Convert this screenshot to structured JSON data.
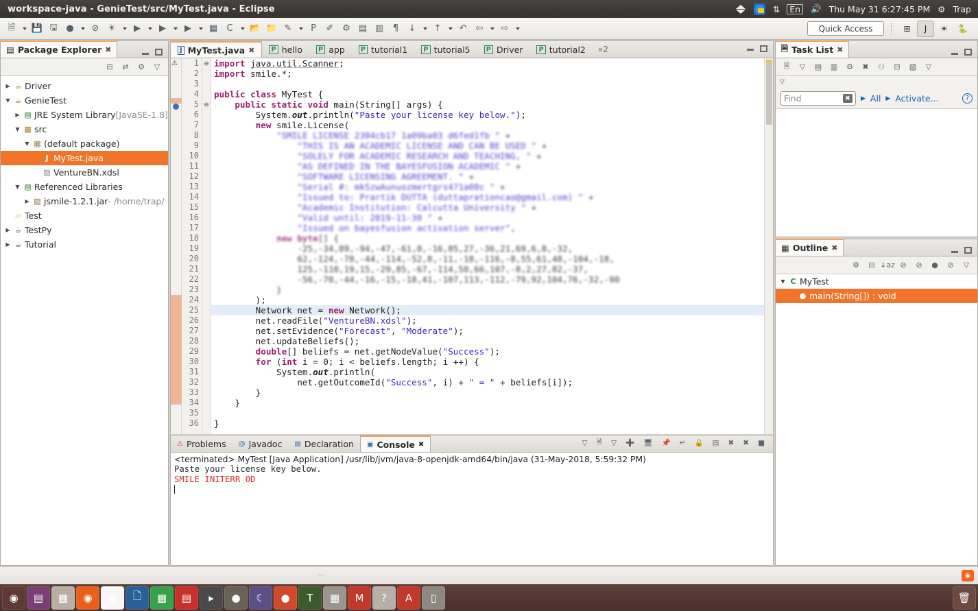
{
  "window": {
    "title": "workspace-java - GenieTest/src/MyTest.java - Eclipse"
  },
  "tray": {
    "dropbox": "dropbox-icon",
    "teamviewer": "teamviewer-icon",
    "network": "network-updown-icon",
    "keyboard_layout": "En",
    "volume": "volume-icon",
    "datetime": "Thu May 31  6:27:45 PM",
    "session_gear": "session-gear-icon",
    "user": "Trap"
  },
  "toolbar": {
    "quick_access": "Quick Access",
    "buttons": [
      {
        "name": "new-wizard",
        "glyph": "🗎"
      },
      {
        "name": "new-wizard-dropdown",
        "glyph": "caret"
      },
      {
        "name": "save",
        "glyph": "💾"
      },
      {
        "name": "save-all",
        "glyph": "🖫"
      },
      {
        "name": "toggle-breadcrumb",
        "glyph": "●"
      },
      {
        "name": "breadcrumb-dropdown",
        "glyph": "caret"
      },
      {
        "name": "skip-breakpoints",
        "glyph": "⊘"
      },
      {
        "name": "debug",
        "glyph": "☀"
      },
      {
        "name": "debug-dropdown",
        "glyph": "caret"
      },
      {
        "name": "run",
        "glyph": "▶"
      },
      {
        "name": "run-dropdown",
        "glyph": "caret"
      },
      {
        "name": "run-external-tools",
        "glyph": "▶"
      },
      {
        "name": "external-tools-dropdown",
        "glyph": "caret"
      },
      {
        "name": "coverage",
        "glyph": "▶"
      },
      {
        "name": "coverage-dropdown",
        "glyph": "caret"
      },
      {
        "name": "new-java-package",
        "glyph": "▦"
      },
      {
        "name": "new-java-class",
        "glyph": "C"
      },
      {
        "name": "new-class-dropdown",
        "glyph": "caret"
      },
      {
        "name": "open-type",
        "glyph": "📂"
      },
      {
        "name": "open-task",
        "glyph": "📁"
      },
      {
        "name": "new-pydev-project",
        "glyph": "✎"
      },
      {
        "name": "pydev-dropdown",
        "glyph": "caret"
      },
      {
        "name": "pydev-package",
        "glyph": "P"
      },
      {
        "name": "pydev-module",
        "glyph": "✐"
      },
      {
        "name": "globals-browser",
        "glyph": "⚙"
      },
      {
        "name": "open-declaration",
        "glyph": "▤"
      },
      {
        "name": "comment-block",
        "glyph": "▥"
      },
      {
        "name": "show-whitespace",
        "glyph": "¶"
      },
      {
        "name": "next-annotation",
        "glyph": "↓"
      },
      {
        "name": "next-annotation-dropdown",
        "glyph": "caret"
      },
      {
        "name": "previous-annotation",
        "glyph": "↑"
      },
      {
        "name": "previous-annotation-dropdown",
        "glyph": "caret"
      },
      {
        "name": "last-edit-location",
        "glyph": "↶"
      },
      {
        "name": "back",
        "glyph": "⇦"
      },
      {
        "name": "back-dropdown",
        "glyph": "caret"
      },
      {
        "name": "forward",
        "glyph": "⇨"
      },
      {
        "name": "forward-dropdown",
        "glyph": "caret"
      }
    ],
    "perspectives": [
      {
        "name": "open-perspective",
        "glyph": "⊞",
        "active": false
      },
      {
        "name": "perspective-java",
        "glyph": "J",
        "active": true
      },
      {
        "name": "perspective-debug",
        "glyph": "☀",
        "active": false
      },
      {
        "name": "perspective-pydev",
        "glyph": "🐍",
        "active": false
      }
    ]
  },
  "package_explorer": {
    "title": "Package Explorer",
    "toolbar": [
      {
        "name": "collapse-all",
        "glyph": "⊟"
      },
      {
        "name": "link-with-editor",
        "glyph": "⇄"
      },
      {
        "name": "view-menu-filters",
        "glyph": "⚙"
      },
      {
        "name": "view-menu",
        "glyph": "▽"
      }
    ],
    "tree": [
      {
        "label": "Driver",
        "icon": "java-project-icon",
        "indent": 0,
        "twisty": "collapsed",
        "selected": false
      },
      {
        "label": "GenieTest",
        "icon": "java-project-icon",
        "indent": 0,
        "twisty": "expanded",
        "selected": false
      },
      {
        "label": "JRE System Library",
        "suffix": "[JavaSE-1.8]",
        "icon": "library-icon",
        "indent": 1,
        "twisty": "collapsed",
        "selected": false
      },
      {
        "label": "src",
        "icon": "source-folder-icon",
        "indent": 1,
        "twisty": "expanded",
        "selected": false
      },
      {
        "label": "(default package)",
        "icon": "package-icon",
        "indent": 2,
        "twisty": "expanded",
        "selected": false
      },
      {
        "label": "MyTest.java",
        "icon": "java-file-icon",
        "indent": 3,
        "twisty": "none",
        "selected": true
      },
      {
        "label": "VentureBN.xdsl",
        "icon": "xml-file-icon",
        "indent": 3,
        "twisty": "none",
        "selected": false
      },
      {
        "label": "Referenced Libraries",
        "icon": "library-icon",
        "indent": 1,
        "twisty": "expanded",
        "selected": false
      },
      {
        "label": "jsmile-1.2.1.jar",
        "suffix": "- /home/trap/",
        "icon": "jar-icon",
        "indent": 2,
        "twisty": "collapsed",
        "selected": false
      },
      {
        "label": "Test",
        "icon": "folder-icon",
        "indent": 0,
        "twisty": "none",
        "selected": false
      },
      {
        "label": "TestPy",
        "icon": "python-project-icon",
        "indent": 0,
        "twisty": "collapsed",
        "selected": false
      },
      {
        "label": "Tutorial",
        "icon": "python-project-icon",
        "indent": 0,
        "twisty": "collapsed",
        "selected": false
      }
    ]
  },
  "editor": {
    "tabs": [
      {
        "label": "MyTest.java",
        "icon": "java-file-icon",
        "active": true,
        "closable": true
      },
      {
        "label": "hello",
        "icon": "python-file-icon",
        "active": false,
        "closable": false
      },
      {
        "label": "app",
        "icon": "python-file-icon",
        "active": false,
        "closable": false
      },
      {
        "label": "tutorial1",
        "icon": "python-file-icon",
        "active": false,
        "closable": false
      },
      {
        "label": "tutorial5",
        "icon": "python-file-icon",
        "active": false,
        "closable": false
      },
      {
        "label": "Driver",
        "icon": "python-file-icon",
        "active": false,
        "closable": false
      },
      {
        "label": "tutorial2",
        "icon": "python-file-icon",
        "active": false,
        "closable": false
      }
    ],
    "overflow_label": "»2",
    "lines": [
      {
        "n": 1,
        "fold": "⊖",
        "blurred": false,
        "html": "<span class=\"kw\">import</span> <span class=\"plain imp\">java.util.Scanner</span><span class=\"plain\">;</span>"
      },
      {
        "n": 2,
        "fold": "",
        "blurred": false,
        "html": "<span class=\"kw\">import</span> <span class=\"plain\">smile.*;</span>"
      },
      {
        "n": 3,
        "fold": "",
        "blurred": false,
        "html": ""
      },
      {
        "n": 4,
        "fold": "",
        "blurred": false,
        "html": "<span class=\"kw\">public class</span> <span class=\"plain\">MyTest {</span>"
      },
      {
        "n": 5,
        "fold": "⊖",
        "blurred": false,
        "html": "    <span class=\"kw\">public static void</span> <span class=\"plain\">main(String[] args) {</span>"
      },
      {
        "n": 6,
        "fold": "",
        "blurred": false,
        "html": "        <span class=\"plain\">System.</span><span class=\"fld\">out</span><span class=\"plain\">.println(</span><span class=\"str\">\"Paste your license key below.\"</span><span class=\"plain\">);</span>"
      },
      {
        "n": 7,
        "fold": "",
        "blurred": false,
        "html": "        <span class=\"kw\">new</span> <span class=\"plain\">smile.License(</span>"
      },
      {
        "n": 8,
        "fold": "",
        "blurred": true,
        "html": "            <span class=\"str\">\"SMILE LICENSE 2304cb17 1a09ba03 d6fed1fb \"</span> <span class=\"plain\">+</span>"
      },
      {
        "n": 9,
        "fold": "",
        "blurred": true,
        "html": "                <span class=\"str\">\"THIS IS AN ACADEMIC LICENSE AND CAN BE USED \"</span> <span class=\"plain\">+</span>"
      },
      {
        "n": 10,
        "fold": "",
        "blurred": true,
        "html": "                <span class=\"str\">\"SOLELY FOR ACADEMIC RESEARCH AND TEACHING, \"</span> <span class=\"plain\">+</span>"
      },
      {
        "n": 11,
        "fold": "",
        "blurred": true,
        "html": "                <span class=\"str\">\"AS DEFINED IN THE BAYESFUSION ACADEMIC \"</span> <span class=\"plain\">+</span>"
      },
      {
        "n": 12,
        "fold": "",
        "blurred": true,
        "html": "                <span class=\"str\">\"SOFTWARE LICENSING AGREEMENT. \"</span> <span class=\"plain\">+</span>"
      },
      {
        "n": 13,
        "fold": "",
        "blurred": true,
        "html": "                <span class=\"str\">\"Serial #: mk5zwAunuozmertgrs471a00c \"</span> <span class=\"plain\">+</span>"
      },
      {
        "n": 14,
        "fold": "",
        "blurred": true,
        "html": "                <span class=\"str\">\"Issued to: Prartik DUTTA (duttaprationcao@gmail.com) \"</span> <span class=\"plain\">+</span>"
      },
      {
        "n": 15,
        "fold": "",
        "blurred": true,
        "html": "                <span class=\"str\">\"Academic Institution: Calcutta University \"</span> <span class=\"plain\">+</span>"
      },
      {
        "n": 16,
        "fold": "",
        "blurred": true,
        "html": "                <span class=\"str\">\"Valid until: 2019-11-30 \"</span> <span class=\"plain\">+</span>"
      },
      {
        "n": 17,
        "fold": "",
        "blurred": true,
        "html": "                <span class=\"str\">\"Issued on bayesfusion activation server\"</span><span class=\"plain\">,</span>"
      },
      {
        "n": 18,
        "fold": "",
        "blurred": true,
        "html": "            <span class=\"kw\">new</span> <span class=\"kw\">byte</span><span class=\"plain\">[] {</span>"
      },
      {
        "n": 19,
        "fold": "",
        "blurred": true,
        "html": "                <span class=\"plain\">-25,-34,89,-94,-47,-61,0,-16,85,27,-36,21,69,6,8,-32,</span>"
      },
      {
        "n": 20,
        "fold": "",
        "blurred": true,
        "html": "                <span class=\"plain\">62,-124,-78,-44,-114,-52,8,-11,-18,-116,-8,55,61,48,-104,-18,</span>"
      },
      {
        "n": 21,
        "fold": "",
        "blurred": true,
        "html": "                <span class=\"plain\">125,-110,19,15,-29,85,-67,-114,50,66,107,-8,2,27,82,-37,</span>"
      },
      {
        "n": 22,
        "fold": "",
        "blurred": true,
        "html": "                <span class=\"plain\">-56,-70,-44,-16,-15,-18,41,-107,113,-112,-79,92,104,76,-32,-90</span>"
      },
      {
        "n": 23,
        "fold": "",
        "blurred": true,
        "html": "            <span class=\"plain\">}</span>"
      },
      {
        "n": 24,
        "fold": "",
        "blurred": false,
        "html": "        <span class=\"plain\">);</span>"
      },
      {
        "n": 25,
        "fold": "",
        "blurred": false,
        "html": "        <span class=\"plain\">Network net = </span><span class=\"kw\">new</span><span class=\"plain\"> Network();</span>"
      },
      {
        "n": 26,
        "fold": "",
        "blurred": false,
        "html": "        <span class=\"plain\">net.readFile(</span><span class=\"str\">\"VentureBN.xdsl\"</span><span class=\"plain\">);</span>"
      },
      {
        "n": 27,
        "fold": "",
        "blurred": false,
        "html": "        <span class=\"plain\">net.setEvidence(</span><span class=\"str\">\"Forecast\"</span><span class=\"plain\">, </span><span class=\"str\">\"Moderate\"</span><span class=\"plain\">);</span>"
      },
      {
        "n": 28,
        "fold": "",
        "blurred": false,
        "html": "        <span class=\"plain\">net.updateBeliefs();</span>"
      },
      {
        "n": 29,
        "fold": "",
        "blurred": false,
        "html": "        <span class=\"kw\">double</span><span class=\"plain\">[] beliefs = net.getNodeValue(</span><span class=\"str\">\"Success\"</span><span class=\"plain\">);</span>"
      },
      {
        "n": 30,
        "fold": "",
        "blurred": false,
        "html": "        <span class=\"kw\">for</span> <span class=\"plain\">(</span><span class=\"kw\">int</span><span class=\"plain\"> i = 0; i &lt; beliefs.length; i ++) {</span>"
      },
      {
        "n": 31,
        "fold": "",
        "blurred": false,
        "html": "            <span class=\"plain\">System.</span><span class=\"fld\">out</span><span class=\"plain\">.println(</span>"
      },
      {
        "n": 32,
        "fold": "",
        "blurred": false,
        "html": "                <span class=\"plain\">net.getOutcomeId(</span><span class=\"str\">\"Success\"</span><span class=\"plain\">, i) + </span><span class=\"str\">\" = \"</span><span class=\"plain\"> + beliefs[i]);</span>"
      },
      {
        "n": 33,
        "fold": "",
        "blurred": false,
        "html": "        <span class=\"plain\">}</span>"
      },
      {
        "n": 34,
        "fold": "",
        "blurred": false,
        "html": "    <span class=\"plain\">}</span>"
      },
      {
        "n": 35,
        "fold": "",
        "blurred": false,
        "html": ""
      },
      {
        "n": 36,
        "fold": "",
        "blurred": false,
        "html": "<span class=\"plain\">}</span>"
      }
    ],
    "highlighted_line": 25
  },
  "console": {
    "tabs": [
      {
        "label": "Problems",
        "icon": "problems-icon",
        "active": false
      },
      {
        "label": "Javadoc",
        "icon": "javadoc-icon",
        "active": false
      },
      {
        "label": "Declaration",
        "icon": "declaration-icon",
        "active": false
      },
      {
        "label": "Console",
        "icon": "console-icon",
        "active": true
      }
    ],
    "toolbar": [
      {
        "name": "terminate",
        "glyph": "■"
      },
      {
        "name": "remove-launch",
        "glyph": "✖"
      },
      {
        "name": "remove-all-terminated",
        "glyph": "✖"
      },
      {
        "name": "clear-console",
        "glyph": "▤"
      },
      {
        "name": "scroll-lock",
        "glyph": "🔒"
      },
      {
        "name": "word-wrap",
        "glyph": "↵"
      },
      {
        "name": "pin-console",
        "glyph": "📌"
      },
      {
        "name": "display-selected-console",
        "glyph": "🖥"
      },
      {
        "name": "open-console",
        "glyph": "➕"
      },
      {
        "name": "open-console-dropdown",
        "glyph": "caret"
      },
      {
        "name": "new-console-view",
        "glyph": "🗎"
      },
      {
        "name": "new-console-dropdown",
        "glyph": "caret"
      }
    ],
    "header": "<terminated> MyTest [Java Application] /usr/lib/jvm/java-8-openjdk-amd64/bin/java (31-May-2018, 5:59:32 PM)",
    "output": [
      {
        "text": "Paste your license key below.",
        "error": false
      },
      {
        "text": "SMILE INITERR 0D",
        "error": true
      }
    ]
  },
  "task_list": {
    "title": "Task List",
    "toolbar": [
      {
        "name": "new-task",
        "glyph": "🗎"
      },
      {
        "name": "new-task-dropdown",
        "glyph": "caret"
      },
      {
        "name": "categorized-presentation",
        "glyph": "▤"
      },
      {
        "name": "scheduled-presentation",
        "glyph": "▥"
      },
      {
        "name": "focus-on-workweek",
        "glyph": "⚙"
      },
      {
        "name": "synchronize-changed",
        "glyph": "✖"
      },
      {
        "name": "collapse-all-tasks",
        "glyph": "⚇"
      },
      {
        "name": "collapse-all",
        "glyph": "⊟"
      },
      {
        "name": "view-menu",
        "glyph": "▧"
      },
      {
        "name": "view-menu-arrow",
        "glyph": "▽"
      }
    ],
    "find_placeholder": "Find",
    "filter_all": "All",
    "filter_activate": "Activate...",
    "help": "?"
  },
  "outline": {
    "title": "Outline",
    "toolbar": [
      {
        "name": "focus-on-active-task",
        "glyph": "⚙"
      },
      {
        "name": "collapse-all",
        "glyph": "⊟"
      },
      {
        "name": "sort",
        "glyph": "↓az"
      },
      {
        "name": "hide-fields",
        "glyph": "⊘"
      },
      {
        "name": "hide-static",
        "glyph": "⊘"
      },
      {
        "name": "hide-non-public",
        "glyph": "●"
      },
      {
        "name": "hide-local-types",
        "glyph": "⊘"
      },
      {
        "name": "view-menu",
        "glyph": "▽"
      }
    ],
    "items": [
      {
        "label": "MyTest",
        "icon": "class-icon",
        "indent": 0,
        "twisty": "expanded",
        "selected": false
      },
      {
        "label": "main(String[]) : void",
        "icon": "method-public-static-icon",
        "indent": 1,
        "twisty": "none",
        "selected": true
      }
    ]
  },
  "status_bar": {
    "grip": "⋯",
    "rss": "rss-icon"
  },
  "dock": {
    "items": [
      {
        "name": "ubuntu-dash",
        "glyph": "◉",
        "color": "#5d3a33"
      },
      {
        "name": "files-manager",
        "glyph": "▤",
        "color": "#7a3f72"
      },
      {
        "name": "archive-manager",
        "glyph": "▦",
        "color": "#b8b0a4"
      },
      {
        "name": "firefox",
        "glyph": "◉",
        "color": "#e8601c"
      },
      {
        "name": "google-chrome",
        "glyph": "◉",
        "color": "#f7f7f7"
      },
      {
        "name": "libreoffice-writer",
        "glyph": "🗋",
        "color": "#2a6099"
      },
      {
        "name": "libreoffice-calc",
        "glyph": "▦",
        "color": "#37a24a"
      },
      {
        "name": "libreoffice-impress",
        "glyph": "▤",
        "color": "#c9302c"
      },
      {
        "name": "terminal",
        "glyph": "▸",
        "color": "#4a4a4a"
      },
      {
        "name": "weather-app",
        "glyph": "●",
        "color": "#6a6258"
      },
      {
        "name": "eclipse-moon",
        "glyph": "☾",
        "color": "#5a4f86"
      },
      {
        "name": "eclipse",
        "glyph": "●",
        "color": "#d04a2a"
      },
      {
        "name": "texmaker",
        "glyph": "T",
        "color": "#3b5c2a"
      },
      {
        "name": "calculator",
        "glyph": "▦",
        "color": "#9a958d"
      },
      {
        "name": "mendeley",
        "glyph": "M",
        "color": "#c0392b"
      },
      {
        "name": "help",
        "glyph": "?",
        "color": "#b5b0a8"
      },
      {
        "name": "adobe-reader",
        "glyph": "A",
        "color": "#c0392b"
      },
      {
        "name": "usb-drive",
        "glyph": "▯",
        "color": "#8d8880"
      }
    ],
    "trash": {
      "name": "trash",
      "glyph": "🗑",
      "color": "#6b4a40"
    }
  }
}
